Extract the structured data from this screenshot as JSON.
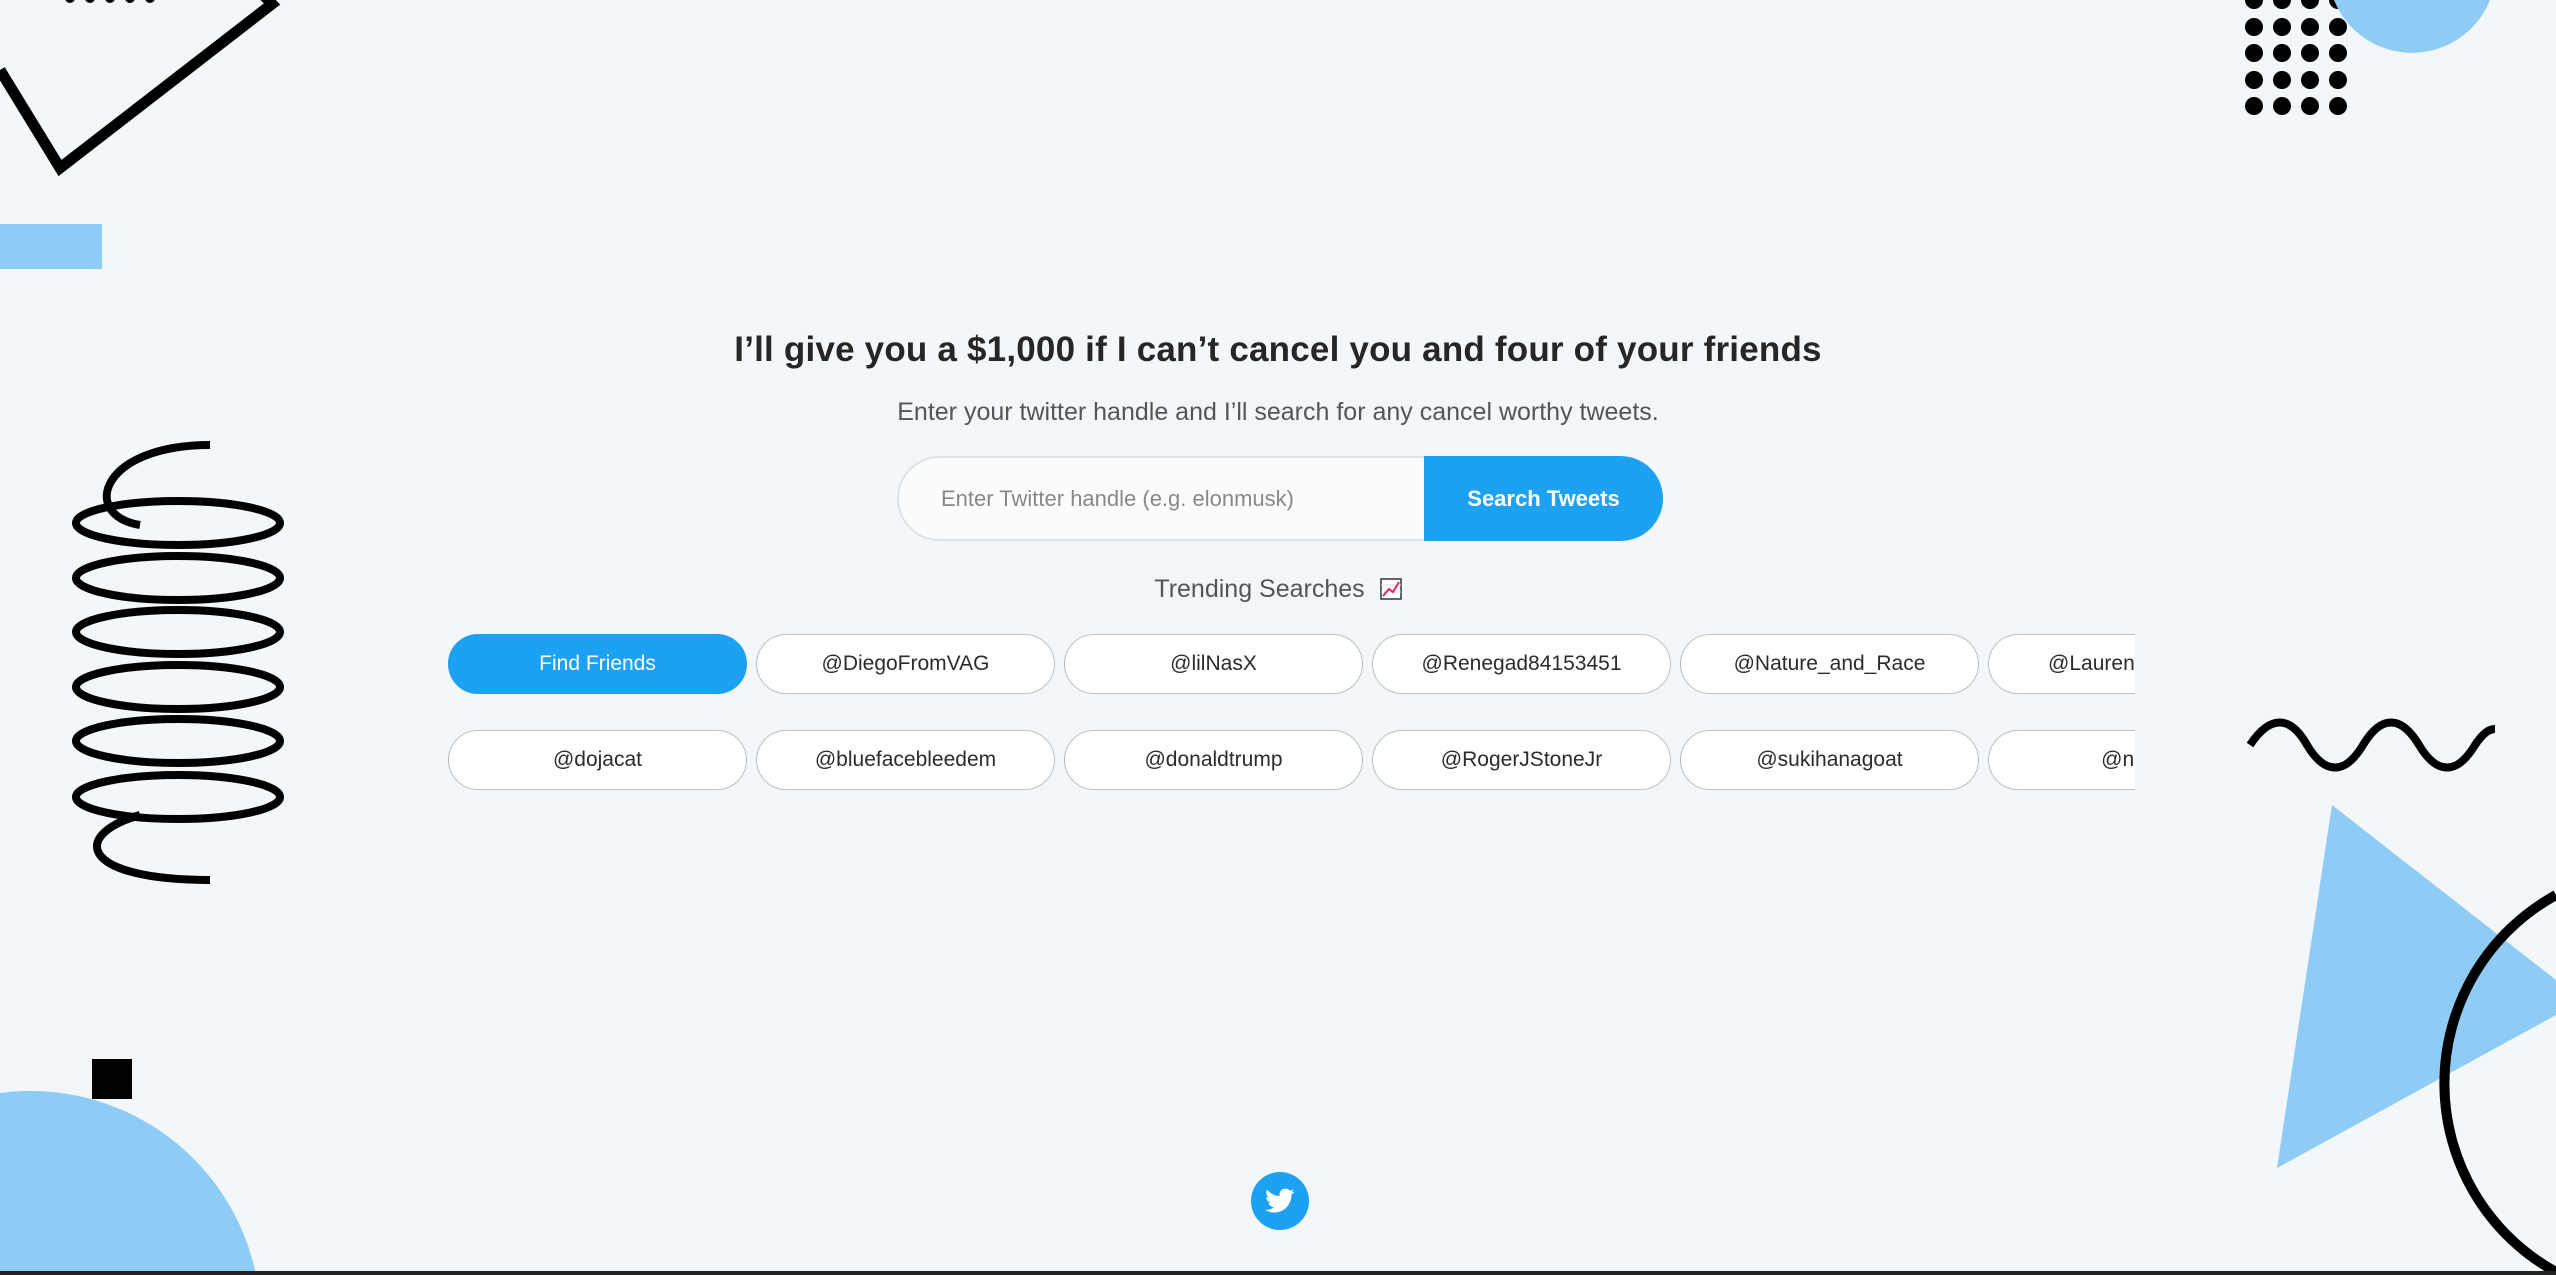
{
  "hero": {
    "headline": "I’ll give you a $1,000 if I can’t cancel you and four of your friends",
    "subline": "Enter your twitter handle and I’ll search for any cancel worthy tweets."
  },
  "search": {
    "placeholder": "Enter Twitter handle (e.g. elonmusk)",
    "value": "",
    "button_label": "Search Tweets"
  },
  "trending": {
    "label": "Trending Searches",
    "icon": "chart-increasing-icon",
    "row1": [
      "Find Friends",
      "@DiegoFromVAG",
      "@lilNasX",
      "@Renegad84153451",
      "@Nature_and_Race",
      "@LaurenWitzkeDE"
    ],
    "row2": [
      "@dojacat",
      "@bluefacebleedem",
      "@donaldtrump",
      "@RogerJStoneJr",
      "@sukihanagoat",
      "@notch"
    ]
  },
  "footer": {
    "icon": "twitter-bird-icon"
  },
  "colors": {
    "accent": "#1da1f2",
    "background": "#f3f7fa",
    "decor_blue": "#8ecbf5",
    "decor_black": "#000000"
  }
}
